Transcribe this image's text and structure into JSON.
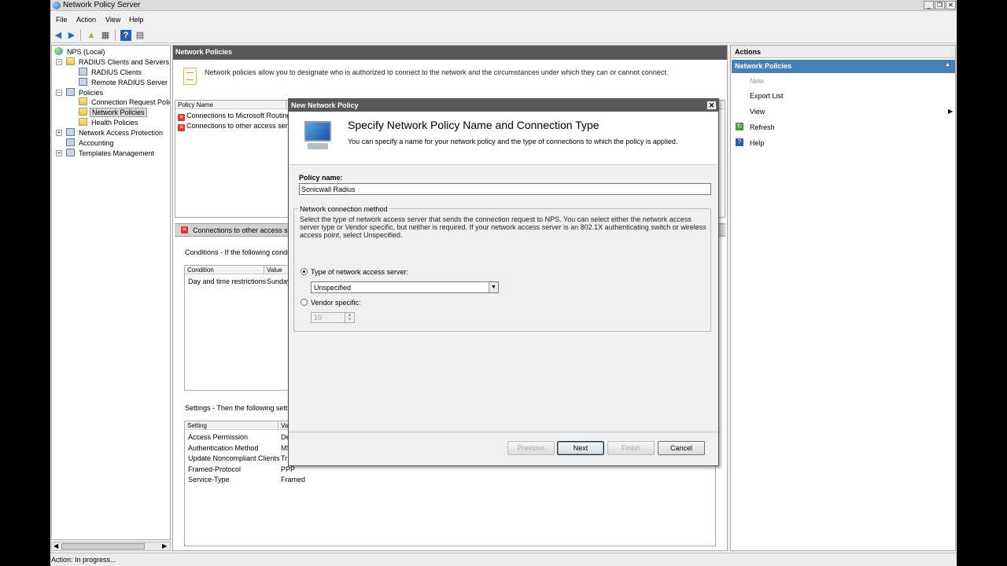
{
  "window": {
    "title": "Network Policy Server"
  },
  "menu": [
    "File",
    "Action",
    "View",
    "Help"
  ],
  "tree": {
    "root": "NPS (Local)",
    "radius_clients_servers": "RADIUS Clients and Servers",
    "radius_clients": "RADIUS Clients",
    "remote_radius": "Remote RADIUS Server G",
    "policies": "Policies",
    "connection_request": "Connection Request Polici",
    "network_policies": "Network Policies",
    "health_policies": "Health Policies",
    "nap": "Network Access Protection",
    "accounting": "Accounting",
    "templates": "Templates Management"
  },
  "center": {
    "header": "Network Policies",
    "info": "Network policies allow you to designate who is authorized to connect to the network and the circumstances under which they can or cannot connect.",
    "list_header": "Policy Name",
    "policies": [
      "Connections to Microsoft Routing",
      "Connections to other access serv"
    ],
    "selected_bar": "Connections to other access se",
    "conditions_label": "Conditions - If the following conditio",
    "conditions_headers": [
      "Condition",
      "Value"
    ],
    "conditions": [
      {
        "condition": "Day and time restrictions",
        "value": "Sunday"
      }
    ],
    "settings_label": "Settings - Then the following setting",
    "settings_headers": [
      "Setting",
      "Va"
    ],
    "settings": [
      {
        "setting": "Access Permission",
        "value": "De"
      },
      {
        "setting": "Authentication Method",
        "value": "MS"
      },
      {
        "setting": "Update Noncompliant Clients",
        "value": "Tr"
      },
      {
        "setting": "Framed-Protocol",
        "value": "PPP"
      },
      {
        "setting": "Service-Type",
        "value": "Framed"
      }
    ]
  },
  "actions": {
    "header": "Actions",
    "section": "Network Policies",
    "items": [
      "New",
      "Export List",
      "View",
      "Refresh",
      "Help"
    ]
  },
  "status": "Action:  In progress...",
  "dialog": {
    "title": "New Network Policy",
    "heading": "Specify Network Policy Name and Connection Type",
    "subheading": "You can specify a name for your network policy and the type of connections to which the policy is applied.",
    "policy_name_label": "Policy name:",
    "policy_name_value": "Sonicwall Radius",
    "group_label": "Network connection method",
    "group_desc": "Select the type of network access server that sends the connection request to NPS. You can select either the network access server type or Vendor specific, but neither is required.  If your network access server is an 802.1X authenticating switch or wireless access point, select Unspecified.",
    "radio_type_label": "Type of network access server:",
    "type_value": "Unspecified",
    "radio_vendor_label": "Vendor specific:",
    "vendor_value": "10",
    "buttons": {
      "previous": "Previous",
      "next": "Next",
      "finish": "Finish",
      "cancel": "Cancel"
    }
  }
}
